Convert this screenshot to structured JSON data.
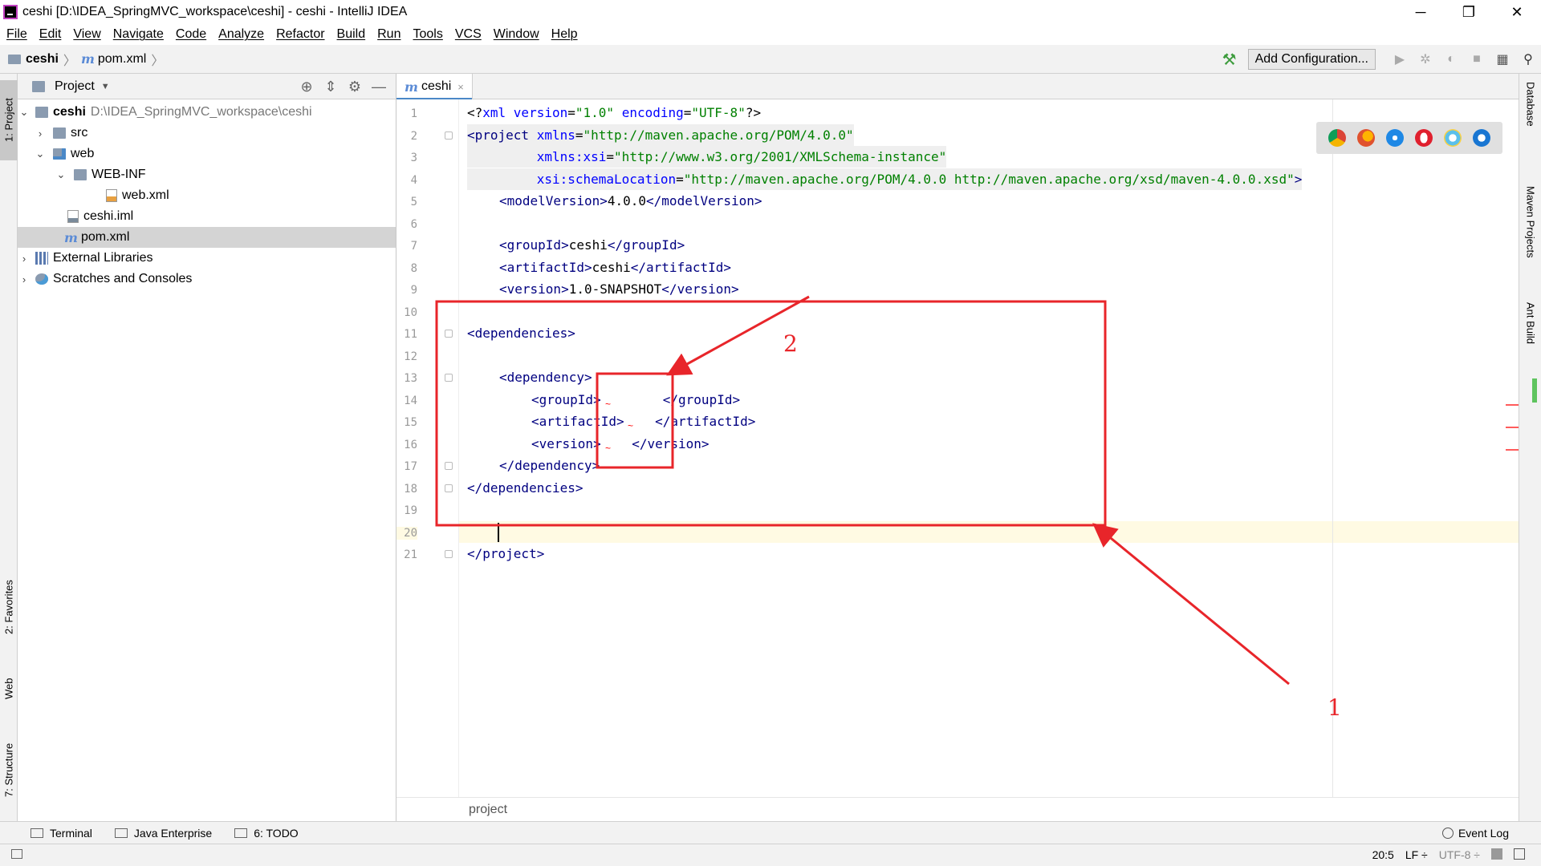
{
  "window": {
    "title": "ceshi [D:\\IDEA_SpringMVC_workspace\\ceshi] - ceshi - IntelliJ IDEA",
    "controls": [
      "─",
      "❐",
      "✕"
    ]
  },
  "menu": [
    "File",
    "Edit",
    "View",
    "Navigate",
    "Code",
    "Analyze",
    "Refactor",
    "Build",
    "Run",
    "Tools",
    "VCS",
    "Window",
    "Help"
  ],
  "nav": {
    "project": "ceshi",
    "file": "pom.xml",
    "add_configuration": "Add Configuration..."
  },
  "left_tabs": {
    "project": "1: Project",
    "favorites": "2: Favorites",
    "web": "Web",
    "structure": "7: Structure"
  },
  "project_panel": {
    "title": "Project",
    "tree": [
      {
        "label": "ceshi",
        "path": "D:\\IDEA_SpringMVC_workspace\\ceshi",
        "icon": "module-folder-icon",
        "arrow": "⌄"
      },
      {
        "label": "src",
        "icon": "folder-icon",
        "arrow": "›"
      },
      {
        "label": "web",
        "icon": "web-folder-icon",
        "arrow": "⌄"
      },
      {
        "label": "WEB-INF",
        "icon": "folder-icon",
        "arrow": "⌄"
      },
      {
        "label": "web.xml",
        "icon": "xml-file-icon"
      },
      {
        "label": "ceshi.iml",
        "icon": "iml-file-icon"
      },
      {
        "label": "pom.xml",
        "icon": "maven-file-icon",
        "selected": true
      },
      {
        "label": "External Libraries",
        "icon": "libraries-icon",
        "arrow": "›"
      },
      {
        "label": "Scratches and Consoles",
        "icon": "scratches-icon",
        "arrow": "›"
      }
    ]
  },
  "editor": {
    "tab_label": "ceshi",
    "tab_close": "×",
    "breadcrumb": "project",
    "line_numbers": [
      "1",
      "2",
      "3",
      "4",
      "5",
      "6",
      "7",
      "8",
      "9",
      "10",
      "11",
      "12",
      "13",
      "14",
      "15",
      "16",
      "17",
      "18",
      "19",
      "20",
      "21"
    ],
    "current_line": "20"
  },
  "right_tabs": {
    "database": "Database",
    "maven": "Maven Projects",
    "ant": "Ant Build"
  },
  "bottom_tools": {
    "terminal": "Terminal",
    "java_enterprise": "Java Enterprise",
    "todo": "6: TODO",
    "event_log": "Event Log"
  },
  "status": {
    "position": "20:5",
    "line_sep": "LF ÷",
    "encoding": "UTF-8 ÷"
  },
  "annotations": {
    "label_1": "1",
    "label_2": "2",
    "color": "#e8252a"
  }
}
